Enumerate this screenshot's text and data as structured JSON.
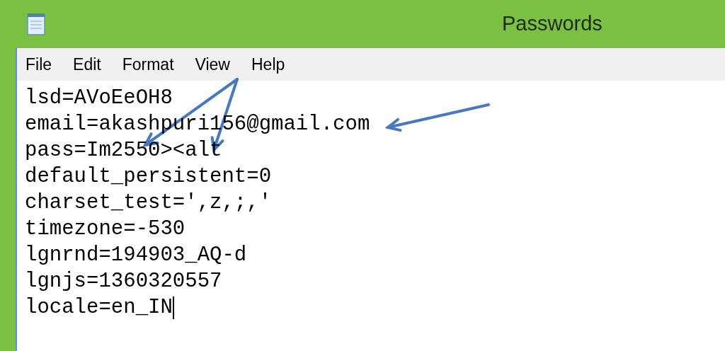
{
  "window": {
    "title": "Passwords"
  },
  "menu": [
    "File",
    "Edit",
    "Format",
    "View",
    "Help"
  ],
  "editor": {
    "lines": [
      "lsd=AVoEeOH8",
      "email=akashpuri156@gmail.com",
      "pass=Im2550><alt",
      "default_persistent=0",
      "charset_test=',z,;,'",
      "timezone=-530",
      "lgnrnd=194903_AQ-d",
      "lgnjs=1360320557",
      "locale=en_IN"
    ]
  }
}
